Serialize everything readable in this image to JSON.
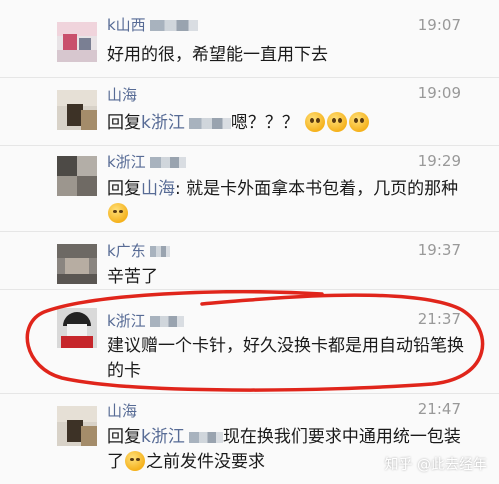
{
  "messages": [
    {
      "name": "k山西",
      "time": "19:07",
      "text": "好用的很，希望能一直用下去"
    },
    {
      "name": "山海",
      "time": "19:09",
      "reply_prefix": "回复",
      "reply_to": "k浙江",
      "text_after": "嗯？？？",
      "emojis": [
        "dizzy-face-emoji",
        "dizzy-face-emoji",
        "dizzy-face-emoji"
      ]
    },
    {
      "name": "k浙江",
      "time": "19:29",
      "reply_prefix": "回复",
      "reply_to": "山海",
      "text_after": ": 就是卡外面拿本书包着，几页的那种",
      "emojis": [
        "tears-of-joy-emoji"
      ]
    },
    {
      "name": "k广东",
      "time": "19:37",
      "text": "辛苦了"
    },
    {
      "name": "k浙江",
      "time": "21:37",
      "text": "建议赠一个卡针，好久没换卡都是用自动铅笔换的卡"
    },
    {
      "name": "山海",
      "time": "21:47",
      "reply_prefix": "回复",
      "reply_to": "k浙江",
      "text_after": "现在换我们要求中通用统一包装了",
      "text_tail": "之前发件没要求",
      "emojis": [
        "tears-of-joy-emoji"
      ]
    }
  ],
  "watermark": "知乎 @此去经年",
  "colors": {
    "link": "#576b95",
    "time": "#999999",
    "text": "#1a1a1a",
    "highlight_ring": "#e0251b",
    "background": "#fafafa"
  }
}
